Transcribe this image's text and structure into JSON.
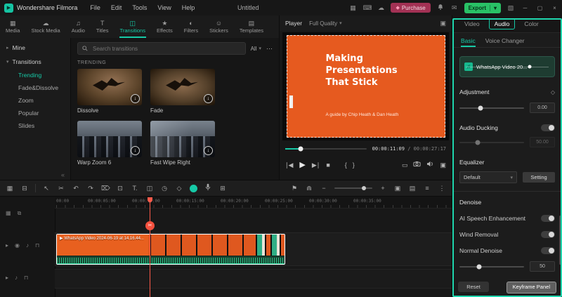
{
  "colors": {
    "accent_teal": "#16c9a6",
    "export_green": "#29c166",
    "purchase_pink": "#a23154",
    "clip_orange": "#e8601f",
    "slide_orange": "#e65a1f",
    "playhead_red": "#ff5a4a"
  },
  "app": {
    "brand": "Wondershare Filmora",
    "menus": [
      "File",
      "Edit",
      "Tools",
      "View",
      "Help"
    ],
    "title": "Untitled",
    "purchase": "Purchase",
    "export": "Export"
  },
  "media_tabs": {
    "items": [
      {
        "label": "Media",
        "icon": "▦"
      },
      {
        "label": "Stock Media",
        "icon": "☁"
      },
      {
        "label": "Audio",
        "icon": "♫"
      },
      {
        "label": "Titles",
        "icon": "T"
      },
      {
        "label": "Transitions",
        "icon": "◫"
      },
      {
        "label": "Effects",
        "icon": "★"
      },
      {
        "label": "Filters",
        "icon": "◐"
      },
      {
        "label": "Stickers",
        "icon": "☺"
      },
      {
        "label": "Templates",
        "icon": "▤"
      }
    ]
  },
  "sidebar": {
    "groups": [
      {
        "label": "Mine"
      },
      {
        "label": "Transitions"
      }
    ],
    "items": [
      {
        "label": "Trending"
      },
      {
        "label": "Fade&Dissolve"
      },
      {
        "label": "Zoom"
      },
      {
        "label": "Popular"
      },
      {
        "label": "Slides"
      }
    ]
  },
  "transitions": {
    "search_placeholder": "Search transitions",
    "filter_all": "All",
    "more": "⋯",
    "section": "TRENDING",
    "cards": [
      {
        "name": "Dissolve"
      },
      {
        "name": "Fade"
      },
      {
        "name": "Warp Zoom 6"
      },
      {
        "name": "Fast Wipe Right"
      }
    ]
  },
  "player": {
    "label": "Player",
    "quality": "Full Quality",
    "slide_title": "Making Presentations That Stick",
    "slide_byline": "A guide by Chip Heath & Dan Heath",
    "time_current": "00:00:11:09",
    "time_sep": "/",
    "time_total": "00:00:27:17"
  },
  "inspector": {
    "tabs": [
      "Video",
      "Audio",
      "Color"
    ],
    "subtabs": [
      "Basic",
      "Voice Changer"
    ],
    "clip_name": "WhatsApp Video 20...",
    "adjustment": {
      "label": "Adjustment",
      "value": "0.00"
    },
    "ducking": {
      "label": "Audio Ducking",
      "value": "50.00"
    },
    "equalizer": {
      "label": "Equalizer",
      "preset": "Default",
      "button": "Setting"
    },
    "denoise_heading": "Denoise",
    "ai_speech": "AI Speech Enhancement",
    "wind": "Wind Removal",
    "normal_denoise": {
      "label": "Normal Denoise",
      "value": "50"
    },
    "reset": "Reset",
    "keyframe_panel": "Keyframe Panel"
  },
  "timeline": {
    "ruler": [
      "00:00",
      "00:00:05:00",
      "00:00:10:00",
      "00:00:15:00",
      "00:00:20:00",
      "00:00:25:00",
      "00:00:30:00",
      "00:00:35:00"
    ],
    "clip_name": "WhatsApp Video 2024-06-19 at 14.16.44..."
  }
}
